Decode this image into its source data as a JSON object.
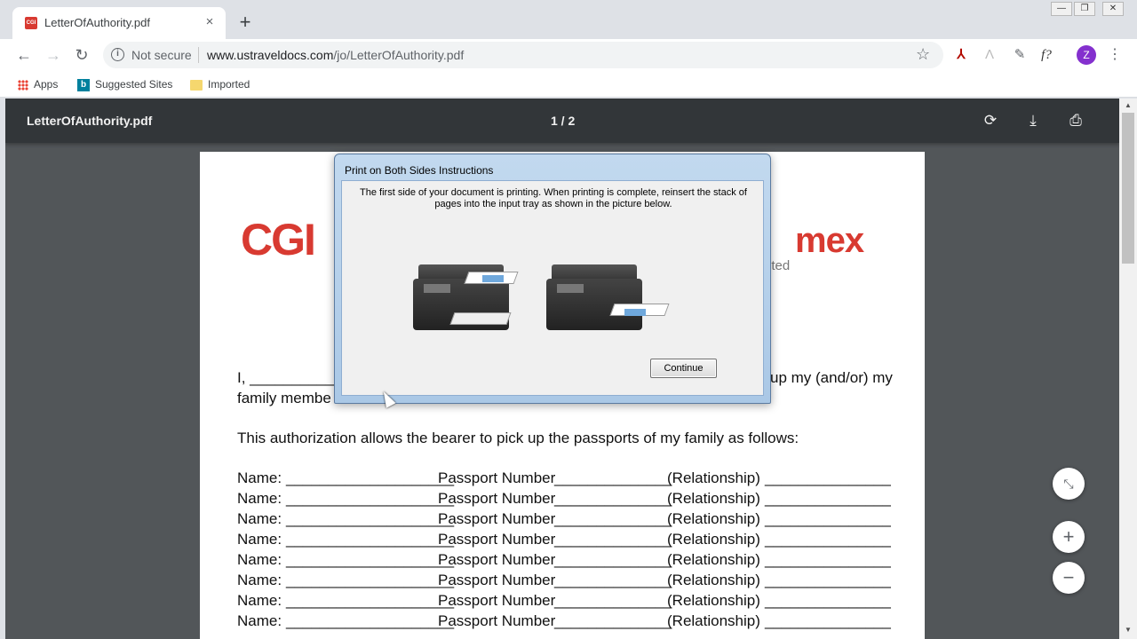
{
  "browser": {
    "tab": {
      "title": "LetterOfAuthority.pdf",
      "favicon_text": "CGI"
    },
    "new_tab_symbol": "+",
    "window_controls": [
      "—",
      "❐",
      "✕"
    ],
    "security_text": "Not secure",
    "url_host": "www.ustraveldocs.com",
    "url_path": "/jo/LetterOfAuthority.pdf",
    "profile_initial": "Z",
    "bookmarks": [
      {
        "label": "Apps",
        "icon": "apps-grid-icon"
      },
      {
        "label": "Suggested Sites",
        "icon": "bing-icon"
      },
      {
        "label": "Imported",
        "icon": "folder-icon"
      }
    ]
  },
  "pdf_viewer": {
    "filename": "LetterOfAuthority.pdf",
    "page_indicator": "1 / 2"
  },
  "document": {
    "logo_left": "CGI",
    "logo_right": "mex",
    "logo_right_sub": "ited",
    "line1_left": "I, ____________",
    "line1_right": "up my (and/or) my",
    "line2": "family membe",
    "authorization": "This authorization allows the bearer to pick up the passports of my family as follows:",
    "row_labels": {
      "name": "Name:",
      "blank1": "____________________",
      "passport": "Passport Number",
      "blank2": "______________",
      "relationship": "(Relationship)",
      "blank3": "_______________"
    },
    "row_count": 8
  },
  "dialog": {
    "title": "Print on Both Sides Instructions",
    "message": "The first side of your document is printing.  When printing is complete, reinsert the stack of pages into the input tray as shown in the picture below.",
    "continue_label": "Continue"
  },
  "zoom_controls": [
    "fit-to-page",
    "zoom-in",
    "zoom-out"
  ]
}
